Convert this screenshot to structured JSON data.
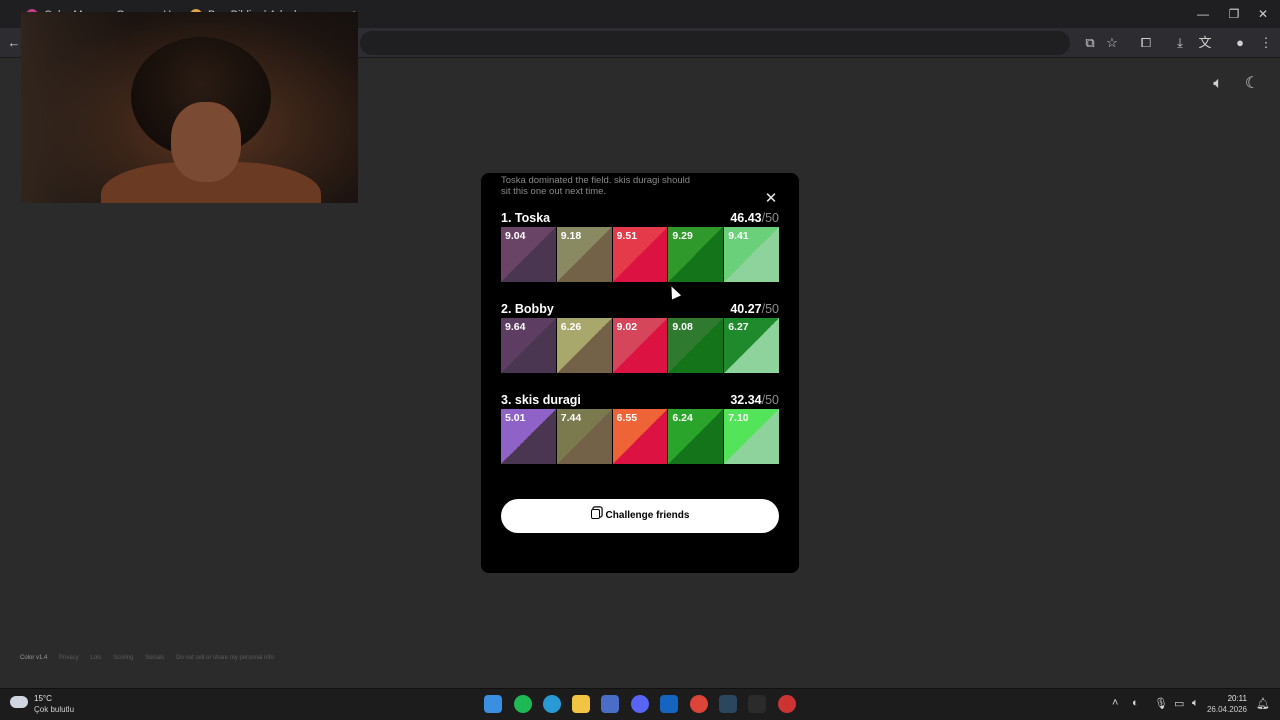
{
  "browser": {
    "tabs": [
      {
        "title": "Color Memory Game — How it",
        "favicon_color": "#c43c8a"
      },
      {
        "title": "Ben Bildim | Adaylarımızın Oyl",
        "favicon_color": "#e0a34a"
      }
    ],
    "new_tab_symbol": "+",
    "window_controls": [
      "—",
      "❐",
      "✕"
    ]
  },
  "page_controls": {
    "sound_icon": "speaker-icon",
    "theme_icon": "moon-icon"
  },
  "results": {
    "summary": "Toska dominated the field. skis duragi should sit this one out next time.",
    "close_symbol": "✕",
    "entries": [
      {
        "name": "1. Toska",
        "score": "46.43",
        "max": "/50",
        "swatches": [
          {
            "value": "9.04",
            "target": "#6a4466",
            "guess": "#4b3651"
          },
          {
            "value": "9.18",
            "target": "#8a8a62",
            "guess": "#736148"
          },
          {
            "value": "9.51",
            "target": "#e43a4a",
            "guess": "#dc1242"
          },
          {
            "value": "9.29",
            "target": "#2f9a2b",
            "guess": "#13741a"
          },
          {
            "value": "9.41",
            "target": "#6ad07a",
            "guess": "#8ed29c"
          }
        ]
      },
      {
        "name": "2. Bobby",
        "score": "40.27",
        "max": "/50",
        "swatches": [
          {
            "value": "9.64",
            "target": "#5e3d63",
            "guess": "#4b3651"
          },
          {
            "value": "6.26",
            "target": "#a8a86c",
            "guess": "#736148"
          },
          {
            "value": "9.02",
            "target": "#d5465a",
            "guess": "#dc1242"
          },
          {
            "value": "9.08",
            "target": "#2e7a2e",
            "guess": "#13741a"
          },
          {
            "value": "6.27",
            "target": "#1f8a2c",
            "guess": "#8ed29c"
          }
        ]
      },
      {
        "name": "3. skis duragi",
        "score": "32.34",
        "max": "/50",
        "swatches": [
          {
            "value": "5.01",
            "target": "#8f62c7",
            "guess": "#4b3651"
          },
          {
            "value": "7.44",
            "target": "#7b7a4e",
            "guess": "#736148"
          },
          {
            "value": "6.55",
            "target": "#ee6436",
            "guess": "#dc1242"
          },
          {
            "value": "6.24",
            "target": "#2aa42a",
            "guess": "#13741a"
          },
          {
            "value": "7.10",
            "target": "#54e45a",
            "guess": "#8ed29c"
          }
        ]
      }
    ],
    "challenge_label": "Challenge friends",
    "challenge_icon": "copy-icon"
  },
  "footer": {
    "version": "Color v1.4",
    "links": [
      "Privacy",
      "Lols",
      "Scoring",
      "Socials",
      "Do not sell or share my personal info"
    ]
  },
  "taskbar": {
    "temperature": "15°C",
    "weather": "Çok bulutlu",
    "apps": [
      {
        "name": "windows-start",
        "color": "#3a8fe0"
      },
      {
        "name": "spotify",
        "color": "#1db954"
      },
      {
        "name": "edge",
        "color": "#2a9ad6"
      },
      {
        "name": "file-explorer",
        "color": "#f2c443"
      },
      {
        "name": "microsoft-store",
        "color": "#4a6ec8"
      },
      {
        "name": "discord",
        "color": "#5865f2"
      },
      {
        "name": "outlook",
        "color": "#1565c0"
      },
      {
        "name": "chrome",
        "color": "#db4437"
      },
      {
        "name": "steam",
        "color": "#2a475e"
      },
      {
        "name": "epic-games",
        "color": "#2b2b2b"
      },
      {
        "name": "recording-app",
        "color": "#cc3333"
      }
    ],
    "time": "20:11",
    "date": "26.04.2026"
  }
}
